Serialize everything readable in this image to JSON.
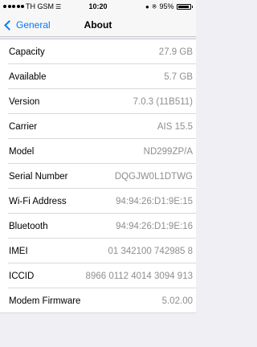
{
  "status_bar": {
    "carrier": "TH GSM",
    "time": "10:20",
    "battery": "95%",
    "battery_level": 0.95
  },
  "nav": {
    "back_label": "General",
    "title": "About"
  },
  "rows": [
    {
      "label": "Capacity",
      "value": "27.9 GB"
    },
    {
      "label": "Available",
      "value": "5.7 GB"
    },
    {
      "label": "Version",
      "value": "7.0.3 (11B511)"
    },
    {
      "label": "Carrier",
      "value": "AIS 15.5"
    },
    {
      "label": "Model",
      "value": "ND299ZP/A"
    },
    {
      "label": "Serial Number",
      "value": "DQGJW0L1DTWG"
    },
    {
      "label": "Wi-Fi Address",
      "value": "94:94:26:D1:9E:15"
    },
    {
      "label": "Bluetooth",
      "value": "94:94:26:D1:9E:16"
    },
    {
      "label": "IMEI",
      "value": "01 342100 742985 8"
    },
    {
      "label": "ICCID",
      "value": "8966 0112 4014 3094 913"
    },
    {
      "label": "Modem Firmware",
      "value": "5.02.00"
    }
  ]
}
